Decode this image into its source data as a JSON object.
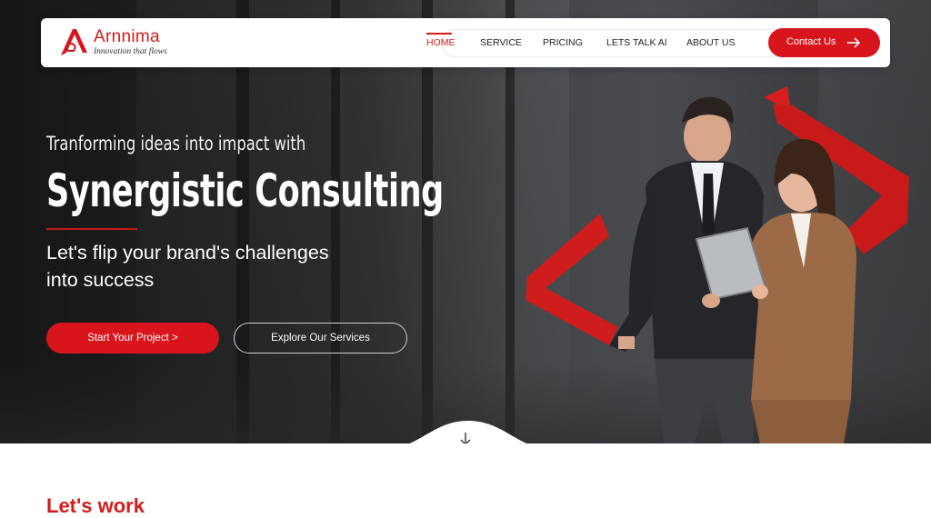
{
  "brand": {
    "name": "Arnnima",
    "tagline": "Innovation that flows",
    "accent_color": "#d8151c"
  },
  "nav": {
    "items": [
      {
        "label": "HOME",
        "active": true
      },
      {
        "label": "SERVICE",
        "active": false
      },
      {
        "label": "PRICING",
        "active": false
      },
      {
        "label": "LETS TALK AI",
        "active": false
      },
      {
        "label": "ABOUT US",
        "active": false
      }
    ],
    "contact_label": "Contact Us",
    "contact_icon": "arrow-right-icon"
  },
  "hero": {
    "tagline": "Tranforming ideas into impact with",
    "headline": "Synergistic Consulting",
    "subhead": "Let's flip your brand's challenges into success",
    "primary_cta": "Start Your Project >",
    "secondary_cta": "Explore Our Services",
    "scroll_icon": "arrow-down-icon"
  },
  "next_section": {
    "title_partial": "Let's work"
  }
}
